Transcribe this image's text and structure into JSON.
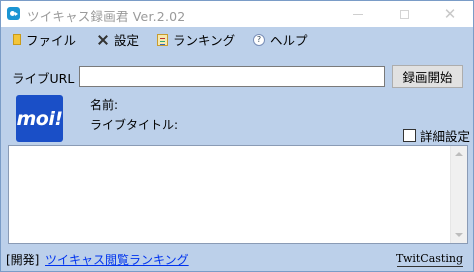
{
  "window": {
    "title": "ツイキャス録画君  Ver.2.02",
    "minimize_label": "",
    "maximize_label": "",
    "close_label": "✕"
  },
  "menu": {
    "items": [
      {
        "label": "ファイル",
        "icon": "file-icon"
      },
      {
        "label": "設定",
        "icon": "settings-icon"
      },
      {
        "label": "ランキング",
        "icon": "ranking-icon"
      },
      {
        "label": "ヘルプ",
        "icon": "help-icon"
      }
    ]
  },
  "url_row": {
    "label": "ライブURL",
    "value": "",
    "placeholder": "",
    "record_button": "録画開始"
  },
  "broadcaster": {
    "avatar_text": "moi!",
    "name_label": "名前:",
    "live_title_label": "ライブタイトル:"
  },
  "options": {
    "detail_settings_label": "詳細設定",
    "detail_settings_checked": false
  },
  "log": {
    "content": ""
  },
  "footer": {
    "prefix": "[開発]",
    "link_text": "ツイキャス閲覧ランキング",
    "brand": "TwitCasting"
  },
  "colors": {
    "background": "#bcd0ea",
    "link": "#0033ee",
    "avatar": "#1a4fc7"
  }
}
